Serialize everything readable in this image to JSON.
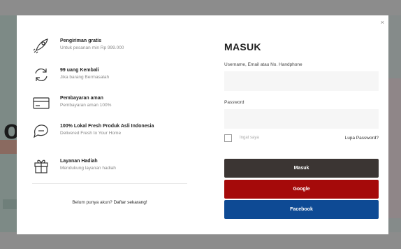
{
  "background": {
    "big_letter": "ol"
  },
  "modal": {
    "close_glyph": "×",
    "features": [
      {
        "icon": "rocket-icon",
        "title": "Pengiriman gratis",
        "subtitle": "Untuk pesanan min Rp 999.000"
      },
      {
        "icon": "refresh-icon",
        "title": "99 uang Kembali",
        "subtitle": "Jika barang Bermasalah"
      },
      {
        "icon": "credit-card-icon",
        "title": "Pembayaran aman",
        "subtitle": "Pembayaran aman 100%"
      },
      {
        "icon": "chat-icon",
        "title": "100% Lokal Fresh Produk Asli Indonesia",
        "subtitle": "Delivered Fresh to Your Home"
      },
      {
        "icon": "gift-icon",
        "title": "Layanan Hadiah",
        "subtitle": "Mendukung layanan hadiah"
      }
    ],
    "register": {
      "prompt": "Belum punya akun?",
      "link": "Daftar sekarang!"
    },
    "login": {
      "title": "MASUK",
      "username_label": "Username, Email atau No. Handphone",
      "username_value": "",
      "password_label": "Password",
      "password_value": "",
      "remember_label": "Ingat saya",
      "forgot_label": "Lupa Password?",
      "submit_label": "Masuk",
      "google_label": "Google",
      "facebook_label": "Facebook"
    }
  },
  "colors": {
    "overlay": "#8c8c8c",
    "masuk_button": "#3b3533",
    "google_button": "#a50a0a",
    "facebook_button": "#0e4a94"
  }
}
